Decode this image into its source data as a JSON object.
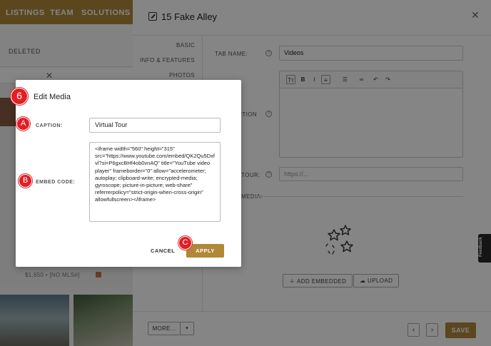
{
  "background": {
    "nav_items": [
      "LISTINGS",
      "TEAM",
      "SOLUTIONS"
    ],
    "filter_label": "DELETED",
    "listing_price": "$1,650 • [NO MLS#]"
  },
  "panel": {
    "title": "15 Fake Alley",
    "side_nav": [
      "BASIC",
      "INFO & FEATURES",
      "PHOTOS"
    ],
    "tab_name_label": "TAB NAME:",
    "tab_name_value": "Videos",
    "description_label": "DESCRIPTION",
    "tour_label": "TOUR:",
    "tour_placeholder": "https://...",
    "media_label": "MEDIA:",
    "add_embedded_label": "ADD EMBEDDED",
    "upload_label": "UPLOAD",
    "more_label": "MORE...",
    "save_label": "SAVE",
    "feedback_label": "Feedback",
    "help_glyph": "?"
  },
  "modal": {
    "title": "Edit Media",
    "caption_label": "CAPTION:",
    "caption_value": "Virtual Tour",
    "embed_label": "EMBED CODE:",
    "embed_value": "<iframe width=\"560\" height=\"315\" src=\"https://www.youtube.com/embed/QK2Qu5Dxfvl?si=P6gxcBHf4ob0vnAQ\" title=\"YouTube video player\" frameborder=\"0\" allow=\"accelerometer; autoplay; clipboard-write; encrypted-media; gyroscope; picture-in-picture; web-share\" referrerpolicy=\"strict-origin-when-cross-origin\" allowfullscreen></iframe>",
    "cancel_label": "CANCEL",
    "apply_label": "APPLY"
  },
  "annotations": {
    "step": "6",
    "a": "A",
    "b": "B",
    "c": "C"
  },
  "colors": {
    "brand_gold": "#b1873a",
    "badge_red": "#e21e26"
  }
}
